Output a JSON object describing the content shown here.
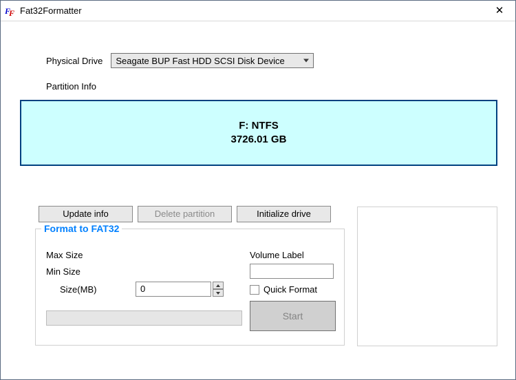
{
  "window": {
    "title": "Fat32Formatter",
    "close": "✕"
  },
  "drive": {
    "label": "Physical Drive",
    "selected": "Seagate BUP Fast HDD SCSI Disk Device"
  },
  "partition": {
    "label": "Partition Info",
    "drive_line": "F: NTFS",
    "size_line": "3726.01 GB"
  },
  "buttons": {
    "update": "Update info",
    "delete": "Delete partition",
    "init": "Initialize drive"
  },
  "format": {
    "group_title": "Format to FAT32",
    "max_size_label": "Max Size",
    "min_size_label": "Min Size",
    "size_mb_label": "Size(MB)",
    "size_value": "0",
    "volume_label_label": "Volume Label",
    "volume_label_value": "",
    "quick_format_label": "Quick Format",
    "start": "Start"
  }
}
